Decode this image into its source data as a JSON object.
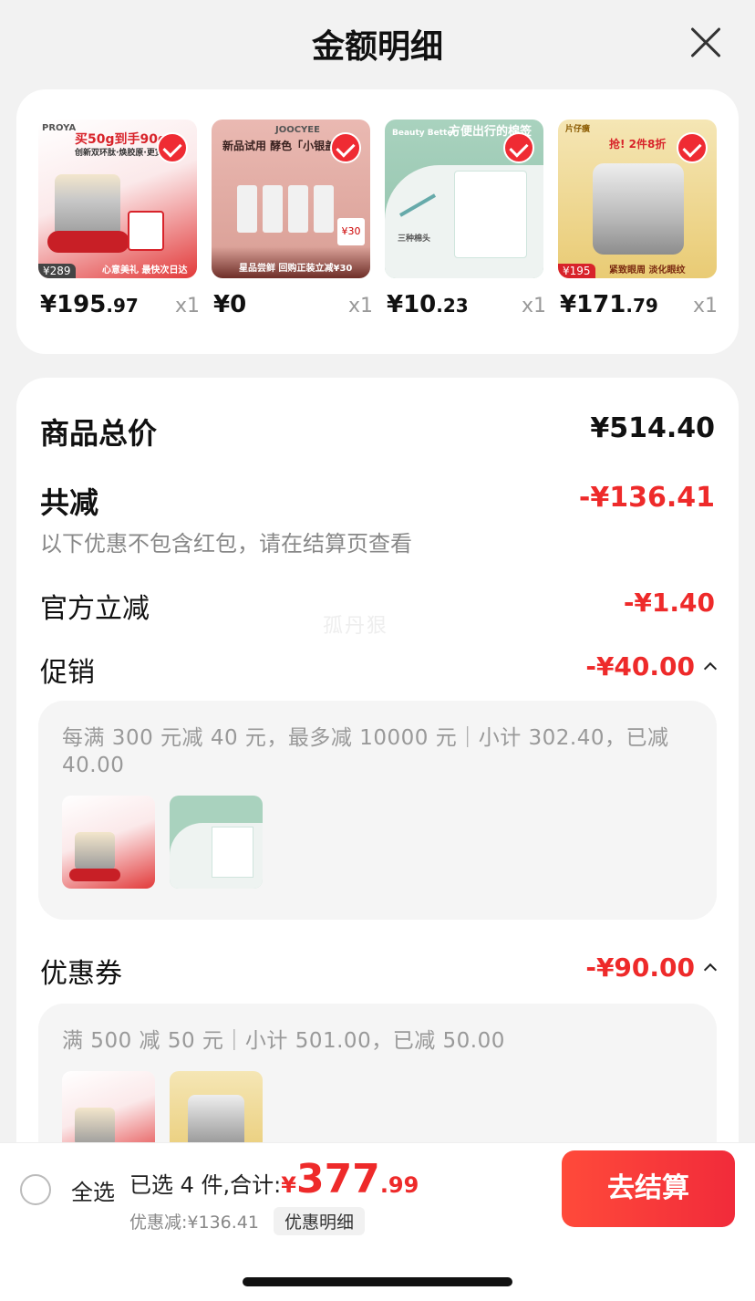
{
  "header": {
    "title": "金额明细"
  },
  "products": [
    {
      "price_int": "¥195",
      "price_dec": ".97",
      "qty": "x1",
      "thumb": {
        "brand": "PROYA",
        "headline": "买50g到手90g",
        "subline": "创新双环肽·焕胶原·更宽",
        "tag": "¥289",
        "bottom_text": "心意美礼 最快次日达",
        "accent": "#d8232a"
      }
    },
    {
      "price_int": "¥0",
      "price_dec": "",
      "qty": "x1",
      "thumb": {
        "brand": "JOOCYEE",
        "headline": "新品试用 酵色「小银盖」",
        "subline": "星品尝鲜 回购正装立减¥30",
        "tag": "¥30",
        "bottom_text": "",
        "accent": "#c9837a"
      }
    },
    {
      "price_int": "¥10",
      "price_dec": ".23",
      "qty": "x1",
      "thumb": {
        "brand": "Beauty Better",
        "headline": "方便出行的棉签",
        "subline": "三种棉头",
        "tag": "",
        "bottom_text": "",
        "accent": "#9ac7b2"
      }
    },
    {
      "price_int": "¥171",
      "price_dec": ".79",
      "qty": "x1",
      "thumb": {
        "brand": "片仔癀",
        "headline": "抢! 2件8折",
        "subline": "紧致眼周 淡化眼纹",
        "tag": "¥195",
        "bottom_text": "",
        "accent": "#e4b94a"
      }
    }
  ],
  "details": {
    "total_label": "商品总价",
    "total_value": "¥514.40",
    "reduce_label": "共减",
    "reduce_value": "-¥136.41",
    "reduce_note": "以下优惠不包含红包，请在结算页查看",
    "official_label": "官方立减",
    "official_value": "-¥1.40",
    "promo_label": "促销",
    "promo_value": "-¥40.00",
    "promo_desc": "每满 300 元减 40 元，最多减 10000 元｜小计 302.40，已减 40.00",
    "coupon_label": "优惠券",
    "coupon_value": "-¥90.00",
    "coupon_desc": "满 500 减 50 元｜小计 501.00，已减 50.00",
    "watermark": "孤丹狠"
  },
  "bottom": {
    "select_all": "全选",
    "selected_text": "已选 4 件,合计:",
    "currency": "¥",
    "total_int": "377",
    "total_dec": ".99",
    "discount_text": "优惠减:¥136.41",
    "detail_link": "优惠明细",
    "checkout": "去结算"
  },
  "colors": {
    "accent_red": "#ee2a2a",
    "checkout_bg": "#f12b3a"
  }
}
